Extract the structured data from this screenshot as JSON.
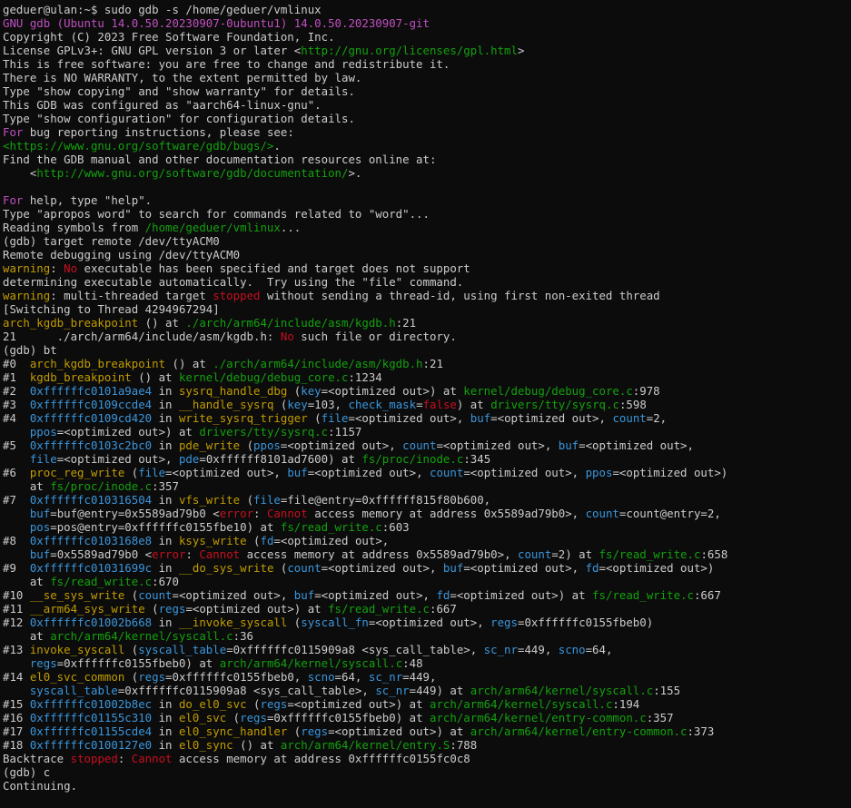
{
  "terminal": {
    "colors": {
      "background": "#0c0c0c",
      "foreground": "#cccccc",
      "magenta": "#c04fc0",
      "green": "#13a10e",
      "yellow": "#c19c00",
      "blue": "#3a96dd",
      "red": "#c50f1f"
    },
    "lines": [
      [
        [
          "d",
          "geduer@ulan:~$ sudo gdb -s /home/geduer/vmlinux"
        ]
      ],
      [
        [
          "m",
          "GNU gdb (Ubuntu 14.0.50.20230907-0ubuntu1) 14.0.50.20230907-git"
        ]
      ],
      [
        [
          "d",
          "Copyright (C) 2023 Free Software Foundation, Inc."
        ]
      ],
      [
        [
          "d",
          "License GPLv3+: GNU GPL version 3 or later <"
        ],
        [
          "g",
          "http://gnu.org/licenses/gpl.html"
        ],
        [
          "d",
          ">"
        ]
      ],
      [
        [
          "d",
          "This is free software: you are free to change and redistribute it."
        ]
      ],
      [
        [
          "d",
          "There is NO WARRANTY, to the extent permitted by law."
        ]
      ],
      [
        [
          "d",
          "Type \"show copying\" and \"show warranty\" for details."
        ]
      ],
      [
        [
          "d",
          "This GDB was configured as \"aarch64-linux-gnu\"."
        ]
      ],
      [
        [
          "d",
          "Type \"show configuration\" for configuration details."
        ]
      ],
      [
        [
          "m",
          "For"
        ],
        [
          "d",
          " bug reporting instructions, please see:"
        ]
      ],
      [
        [
          "g",
          "<https://www.gnu.org/software/gdb/bugs/>"
        ],
        [
          "d",
          "."
        ]
      ],
      [
        [
          "d",
          "Find the GDB manual and other documentation resources online at:"
        ]
      ],
      [
        [
          "d",
          "    <"
        ],
        [
          "g",
          "http://www.gnu.org/software/gdb/documentation/"
        ],
        [
          "d",
          ">."
        ]
      ],
      [
        [
          "d",
          ""
        ]
      ],
      [
        [
          "m",
          "For"
        ],
        [
          "d",
          " help, type \"help\"."
        ]
      ],
      [
        [
          "d",
          "Type \"apropos word\" to search for commands related to \"word\"..."
        ]
      ],
      [
        [
          "d",
          "Reading symbols from "
        ],
        [
          "g",
          "/home/geduer/vmlinux"
        ],
        [
          "d",
          "..."
        ]
      ],
      [
        [
          "d",
          "(gdb) target remote /dev/ttyACM0"
        ]
      ],
      [
        [
          "d",
          "Remote debugging using /dev/ttyACM0"
        ]
      ],
      [
        [
          "y",
          "warning"
        ],
        [
          "d",
          ": "
        ],
        [
          "r",
          "No"
        ],
        [
          "d",
          " executable has been specified and target does not support"
        ]
      ],
      [
        [
          "d",
          "determining executable automatically.  Try using the \"file\" command."
        ]
      ],
      [
        [
          "y",
          "warning"
        ],
        [
          "d",
          ": multi-threaded target "
        ],
        [
          "r",
          "stopped"
        ],
        [
          "d",
          " without sending a thread-id, using first non-exited thread"
        ]
      ],
      [
        [
          "d",
          "[Switching to Thread 4294967294]"
        ]
      ],
      [
        [
          "y",
          "arch_kgdb_breakpoint"
        ],
        [
          "d",
          " () at "
        ],
        [
          "g",
          "./arch/arm64/include/asm/kgdb.h"
        ],
        [
          "d",
          ":21"
        ]
      ],
      [
        [
          "d",
          "21      ./arch/arm64/include/asm/kgdb.h: "
        ],
        [
          "r",
          "No"
        ],
        [
          "d",
          " such file or directory."
        ]
      ],
      [
        [
          "d",
          "(gdb) bt"
        ]
      ],
      [
        [
          "d",
          "#0  "
        ],
        [
          "y",
          "arch_kgdb_breakpoint"
        ],
        [
          "d",
          " () at "
        ],
        [
          "g",
          "./arch/arm64/include/asm/kgdb.h"
        ],
        [
          "d",
          ":21"
        ]
      ],
      [
        [
          "d",
          "#1  "
        ],
        [
          "y",
          "kgdb_breakpoint"
        ],
        [
          "d",
          " () at "
        ],
        [
          "g",
          "kernel/debug/debug_core.c"
        ],
        [
          "d",
          ":1234"
        ]
      ],
      [
        [
          "d",
          "#2  "
        ],
        [
          "b",
          "0xffffffc0101a9ae4"
        ],
        [
          "d",
          " in "
        ],
        [
          "y",
          "sysrq_handle_dbg"
        ],
        [
          "d",
          " ("
        ],
        [
          "b",
          "key"
        ],
        [
          "d",
          "=<optimized out>) at "
        ],
        [
          "g",
          "kernel/debug/debug_core.c"
        ],
        [
          "d",
          ":978"
        ]
      ],
      [
        [
          "d",
          "#3  "
        ],
        [
          "b",
          "0xffffffc0109ccde4"
        ],
        [
          "d",
          " in "
        ],
        [
          "y",
          "__handle_sysrq"
        ],
        [
          "d",
          " ("
        ],
        [
          "b",
          "key"
        ],
        [
          "d",
          "=103, "
        ],
        [
          "b",
          "check_mask"
        ],
        [
          "d",
          "="
        ],
        [
          "r",
          "false"
        ],
        [
          "d",
          ") at "
        ],
        [
          "g",
          "drivers/tty/sysrq.c"
        ],
        [
          "d",
          ":598"
        ]
      ],
      [
        [
          "d",
          "#4  "
        ],
        [
          "b",
          "0xffffffc0109cd420"
        ],
        [
          "d",
          " in "
        ],
        [
          "y",
          "write_sysrq_trigger"
        ],
        [
          "d",
          " ("
        ],
        [
          "b",
          "file"
        ],
        [
          "d",
          "=<optimized out>, "
        ],
        [
          "b",
          "buf"
        ],
        [
          "d",
          "=<optimized out>, "
        ],
        [
          "b",
          "count"
        ],
        [
          "d",
          "=2,"
        ]
      ],
      [
        [
          "d",
          "    "
        ],
        [
          "b",
          "ppos"
        ],
        [
          "d",
          "=<optimized out>) at "
        ],
        [
          "g",
          "drivers/tty/sysrq.c"
        ],
        [
          "d",
          ":1157"
        ]
      ],
      [
        [
          "d",
          "#5  "
        ],
        [
          "b",
          "0xffffffc0103c2bc0"
        ],
        [
          "d",
          " in "
        ],
        [
          "y",
          "pde_write"
        ],
        [
          "d",
          " ("
        ],
        [
          "b",
          "ppos"
        ],
        [
          "d",
          "=<optimized out>, "
        ],
        [
          "b",
          "count"
        ],
        [
          "d",
          "=<optimized out>, "
        ],
        [
          "b",
          "buf"
        ],
        [
          "d",
          "=<optimized out>,"
        ]
      ],
      [
        [
          "d",
          "    "
        ],
        [
          "b",
          "file"
        ],
        [
          "d",
          "=<optimized out>, "
        ],
        [
          "b",
          "pde"
        ],
        [
          "d",
          "=0xffffff8101ad7600) at "
        ],
        [
          "g",
          "fs/proc/inode.c"
        ],
        [
          "d",
          ":345"
        ]
      ],
      [
        [
          "d",
          "#6  "
        ],
        [
          "y",
          "proc_reg_write"
        ],
        [
          "d",
          " ("
        ],
        [
          "b",
          "file"
        ],
        [
          "d",
          "=<optimized out>, "
        ],
        [
          "b",
          "buf"
        ],
        [
          "d",
          "=<optimized out>, "
        ],
        [
          "b",
          "count"
        ],
        [
          "d",
          "=<optimized out>, "
        ],
        [
          "b",
          "ppos"
        ],
        [
          "d",
          "=<optimized out>)"
        ]
      ],
      [
        [
          "d",
          "    at "
        ],
        [
          "g",
          "fs/proc/inode.c"
        ],
        [
          "d",
          ":357"
        ]
      ],
      [
        [
          "d",
          "#7  "
        ],
        [
          "b",
          "0xffffffc010316504"
        ],
        [
          "d",
          " in "
        ],
        [
          "y",
          "vfs_write"
        ],
        [
          "d",
          " ("
        ],
        [
          "b",
          "file"
        ],
        [
          "d",
          "=file@entry=0xffffff815f80b600,"
        ]
      ],
      [
        [
          "d",
          "    "
        ],
        [
          "b",
          "buf"
        ],
        [
          "d",
          "=buf@entry=0x5589ad79b0 <"
        ],
        [
          "r",
          "error"
        ],
        [
          "d",
          ": "
        ],
        [
          "r",
          "Cannot"
        ],
        [
          "d",
          " access memory at address 0x5589ad79b0>, "
        ],
        [
          "b",
          "count"
        ],
        [
          "d",
          "=count@entry=2,"
        ]
      ],
      [
        [
          "d",
          "    "
        ],
        [
          "b",
          "pos"
        ],
        [
          "d",
          "=pos@entry=0xffffffc0155fbe10) at "
        ],
        [
          "g",
          "fs/read_write.c"
        ],
        [
          "d",
          ":603"
        ]
      ],
      [
        [
          "d",
          "#8  "
        ],
        [
          "b",
          "0xffffffc0103168e8"
        ],
        [
          "d",
          " in "
        ],
        [
          "y",
          "ksys_write"
        ],
        [
          "d",
          " ("
        ],
        [
          "b",
          "fd"
        ],
        [
          "d",
          "=<optimized out>,"
        ]
      ],
      [
        [
          "d",
          "    "
        ],
        [
          "b",
          "buf"
        ],
        [
          "d",
          "=0x5589ad79b0 <"
        ],
        [
          "r",
          "error"
        ],
        [
          "d",
          ": "
        ],
        [
          "r",
          "Cannot"
        ],
        [
          "d",
          " access memory at address 0x5589ad79b0>, "
        ],
        [
          "b",
          "count"
        ],
        [
          "d",
          "=2) at "
        ],
        [
          "g",
          "fs/read_write.c"
        ],
        [
          "d",
          ":658"
        ]
      ],
      [
        [
          "d",
          "#9  "
        ],
        [
          "b",
          "0xffffffc01031699c"
        ],
        [
          "d",
          " in "
        ],
        [
          "y",
          "__do_sys_write"
        ],
        [
          "d",
          " ("
        ],
        [
          "b",
          "count"
        ],
        [
          "d",
          "=<optimized out>, "
        ],
        [
          "b",
          "buf"
        ],
        [
          "d",
          "=<optimized out>, "
        ],
        [
          "b",
          "fd"
        ],
        [
          "d",
          "=<optimized out>)"
        ]
      ],
      [
        [
          "d",
          "    at "
        ],
        [
          "g",
          "fs/read_write.c"
        ],
        [
          "d",
          ":670"
        ]
      ],
      [
        [
          "d",
          "#10 "
        ],
        [
          "y",
          "__se_sys_write"
        ],
        [
          "d",
          " ("
        ],
        [
          "b",
          "count"
        ],
        [
          "d",
          "=<optimized out>, "
        ],
        [
          "b",
          "buf"
        ],
        [
          "d",
          "=<optimized out>, "
        ],
        [
          "b",
          "fd"
        ],
        [
          "d",
          "=<optimized out>) at "
        ],
        [
          "g",
          "fs/read_write.c"
        ],
        [
          "d",
          ":667"
        ]
      ],
      [
        [
          "d",
          "#11 "
        ],
        [
          "y",
          "__arm64_sys_write"
        ],
        [
          "d",
          " ("
        ],
        [
          "b",
          "regs"
        ],
        [
          "d",
          "=<optimized out>) at "
        ],
        [
          "g",
          "fs/read_write.c"
        ],
        [
          "d",
          ":667"
        ]
      ],
      [
        [
          "d",
          "#12 "
        ],
        [
          "b",
          "0xffffffc01002b668"
        ],
        [
          "d",
          " in "
        ],
        [
          "y",
          "__invoke_syscall"
        ],
        [
          "d",
          " ("
        ],
        [
          "b",
          "syscall_fn"
        ],
        [
          "d",
          "=<optimized out>, "
        ],
        [
          "b",
          "regs"
        ],
        [
          "d",
          "=0xffffffc0155fbeb0)"
        ]
      ],
      [
        [
          "d",
          "    at "
        ],
        [
          "g",
          "arch/arm64/kernel/syscall.c"
        ],
        [
          "d",
          ":36"
        ]
      ],
      [
        [
          "d",
          "#13 "
        ],
        [
          "y",
          "invoke_syscall"
        ],
        [
          "d",
          " ("
        ],
        [
          "b",
          "syscall_table"
        ],
        [
          "d",
          "=0xffffffc0115909a8 <sys_call_table>, "
        ],
        [
          "b",
          "sc_nr"
        ],
        [
          "d",
          "=449, "
        ],
        [
          "b",
          "scno"
        ],
        [
          "d",
          "=64,"
        ]
      ],
      [
        [
          "d",
          "    "
        ],
        [
          "b",
          "regs"
        ],
        [
          "d",
          "=0xffffffc0155fbeb0) at "
        ],
        [
          "g",
          "arch/arm64/kernel/syscall.c"
        ],
        [
          "d",
          ":48"
        ]
      ],
      [
        [
          "d",
          "#14 "
        ],
        [
          "y",
          "el0_svc_common"
        ],
        [
          "d",
          " ("
        ],
        [
          "b",
          "regs"
        ],
        [
          "d",
          "=0xffffffc0155fbeb0, "
        ],
        [
          "b",
          "scno"
        ],
        [
          "d",
          "=64, "
        ],
        [
          "b",
          "sc_nr"
        ],
        [
          "d",
          "=449,"
        ]
      ],
      [
        [
          "d",
          "    "
        ],
        [
          "b",
          "syscall_table"
        ],
        [
          "d",
          "=0xffffffc0115909a8 <sys_call_table>, "
        ],
        [
          "b",
          "sc_nr"
        ],
        [
          "d",
          "=449) at "
        ],
        [
          "g",
          "arch/arm64/kernel/syscall.c"
        ],
        [
          "d",
          ":155"
        ]
      ],
      [
        [
          "d",
          "#15 "
        ],
        [
          "b",
          "0xffffffc01002b8ec"
        ],
        [
          "d",
          " in "
        ],
        [
          "y",
          "do_el0_svc"
        ],
        [
          "d",
          " ("
        ],
        [
          "b",
          "regs"
        ],
        [
          "d",
          "=<optimized out>) at "
        ],
        [
          "g",
          "arch/arm64/kernel/syscall.c"
        ],
        [
          "d",
          ":194"
        ]
      ],
      [
        [
          "d",
          "#16 "
        ],
        [
          "b",
          "0xffffffc01155c310"
        ],
        [
          "d",
          " in "
        ],
        [
          "y",
          "el0_svc"
        ],
        [
          "d",
          " ("
        ],
        [
          "b",
          "regs"
        ],
        [
          "d",
          "=0xffffffc0155fbeb0) at "
        ],
        [
          "g",
          "arch/arm64/kernel/entry-common.c"
        ],
        [
          "d",
          ":357"
        ]
      ],
      [
        [
          "d",
          "#17 "
        ],
        [
          "b",
          "0xffffffc01155cde4"
        ],
        [
          "d",
          " in "
        ],
        [
          "y",
          "el0_sync_handler"
        ],
        [
          "d",
          " ("
        ],
        [
          "b",
          "regs"
        ],
        [
          "d",
          "=<optimized out>) at "
        ],
        [
          "g",
          "arch/arm64/kernel/entry-common.c"
        ],
        [
          "d",
          ":373"
        ]
      ],
      [
        [
          "d",
          "#18 "
        ],
        [
          "b",
          "0xffffffc0100127e0"
        ],
        [
          "d",
          " in "
        ],
        [
          "y",
          "el0_sync"
        ],
        [
          "d",
          " () at "
        ],
        [
          "g",
          "arch/arm64/kernel/entry.S"
        ],
        [
          "d",
          ":788"
        ]
      ],
      [
        [
          "d",
          "Backtrace "
        ],
        [
          "r",
          "stopped"
        ],
        [
          "d",
          ": "
        ],
        [
          "r",
          "Cannot"
        ],
        [
          "d",
          " access memory at address 0xffffffc0155fc0c8"
        ]
      ],
      [
        [
          "d",
          "(gdb) c"
        ]
      ],
      [
        [
          "d",
          "Continuing."
        ]
      ]
    ]
  }
}
